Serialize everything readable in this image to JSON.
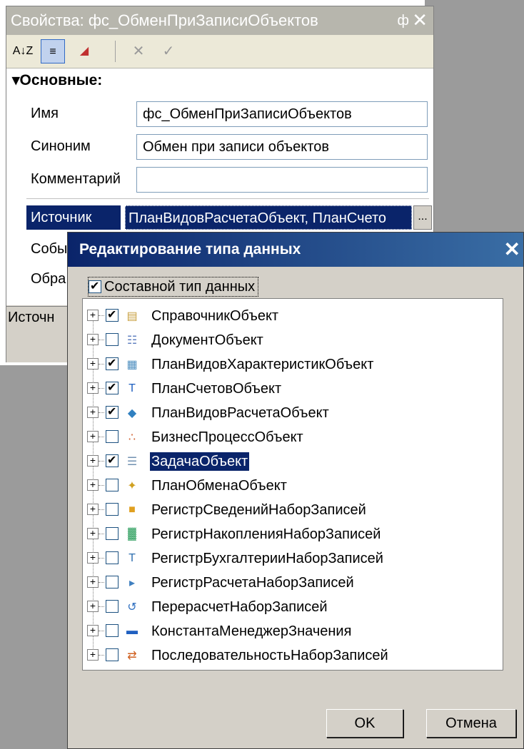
{
  "properties_panel": {
    "title": "Свойства: фс_ОбменПриЗаписиОбъектов",
    "pin_glyph": "ф",
    "close_glyph": "✕",
    "toolbar": {
      "sort_az": "A↓Z",
      "categorized": "≡",
      "filter": "◢",
      "cancel": "✕",
      "apply": "✓"
    },
    "section": "Основные:",
    "fields": {
      "name_label": "Имя",
      "name_value": "фс_ОбменПриЗаписиОбъектов",
      "synonym_label": "Синоним",
      "synonym_value": "Обмен при записи объектов",
      "comment_label": "Комментарий",
      "comment_value": ""
    },
    "source_label": "Источник",
    "source_value": "ПланВидовРасчетаОбъект, ПланСчето",
    "event_label": "Собы",
    "handler_label": "Обра",
    "status_text": "Источн"
  },
  "dialog": {
    "title": "Редактирование типа данных",
    "close_glyph": "✕",
    "composite_label": "Составной тип данных",
    "composite_checked": true,
    "items": [
      {
        "label": "СправочникОбъект",
        "checked": true,
        "icon": "catalog-icon",
        "selected": false
      },
      {
        "label": "ДокументОбъект",
        "checked": false,
        "icon": "document-icon",
        "selected": false
      },
      {
        "label": "ПланВидовХарактеристикОбъект",
        "checked": true,
        "icon": "characteristics-icon",
        "selected": false
      },
      {
        "label": "ПланСчетовОбъект",
        "checked": true,
        "icon": "chart-of-accounts-icon",
        "selected": false
      },
      {
        "label": "ПланВидовРасчетаОбъект",
        "checked": true,
        "icon": "calculation-types-icon",
        "selected": false
      },
      {
        "label": "БизнесПроцессОбъект",
        "checked": false,
        "icon": "business-process-icon",
        "selected": false
      },
      {
        "label": "ЗадачаОбъект",
        "checked": true,
        "icon": "task-icon",
        "selected": true
      },
      {
        "label": "ПланОбменаОбъект",
        "checked": false,
        "icon": "exchange-plan-icon",
        "selected": false
      },
      {
        "label": "РегистрСведенийНаборЗаписей",
        "checked": false,
        "icon": "info-register-icon",
        "selected": false
      },
      {
        "label": "РегистрНакопленияНаборЗаписей",
        "checked": false,
        "icon": "accumulation-register-icon",
        "selected": false
      },
      {
        "label": "РегистрБухгалтерииНаборЗаписей",
        "checked": false,
        "icon": "accounting-register-icon",
        "selected": false
      },
      {
        "label": "РегистрРасчетаНаборЗаписей",
        "checked": false,
        "icon": "calculation-register-icon",
        "selected": false
      },
      {
        "label": "ПерерасчетНаборЗаписей",
        "checked": false,
        "icon": "recalculation-icon",
        "selected": false
      },
      {
        "label": "КонстантаМенеджерЗначения",
        "checked": false,
        "icon": "constant-icon",
        "selected": false
      },
      {
        "label": "ПоследовательностьНаборЗаписей",
        "checked": false,
        "icon": "sequence-icon",
        "selected": false
      }
    ],
    "ok_label": "OK",
    "cancel_label": "Отмена"
  }
}
